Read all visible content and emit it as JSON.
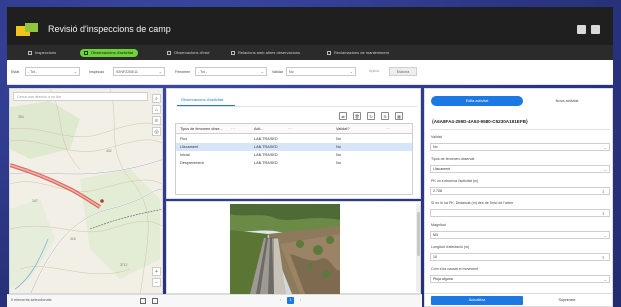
{
  "app": {
    "title": "Revisió d'inspeccions de camp"
  },
  "tabs": [
    {
      "label": "Inspeccions",
      "active": false
    },
    {
      "label": "Observacions d'activitat",
      "active": true
    },
    {
      "label": "Observacions d'inici",
      "active": false
    },
    {
      "label": "Relacions amb altres observacions",
      "active": false
    },
    {
      "label": "Reclamacions de manteniment",
      "active": false
    }
  ],
  "filters": {
    "f1_label": "Estat",
    "f1_value": "- Tot -",
    "f2_label": "Inspecció",
    "f2_value": "S/INF2208/11",
    "f3_label": "Fenomen",
    "f3_value": "- Tot -",
    "f4_label": "Validat",
    "f4_value": "No",
    "apply_label": "Aplica",
    "reset_label": "Esborra"
  },
  "map": {
    "search_placeholder": "Cerca una direcció o un lloc",
    "labels": [
      "354",
      "402",
      "347",
      "318",
      "3712"
    ],
    "zoom_in": "+",
    "zoom_out": "−"
  },
  "footer": {
    "selection_text": "0 elements seleccionats"
  },
  "observations": {
    "tab_label": "Observacions d'activitat",
    "columns": [
      "Tipus de fenomen obse...",
      "Acti...",
      "Validat?"
    ],
    "rows": [
      {
        "type": "Flux",
        "activity": "LAB.TRASED",
        "valid": "No",
        "selected": false
      },
      {
        "type": "Lliscament",
        "activity": "LAB.TRASED",
        "valid": "No",
        "selected": true
      },
      {
        "type": "Inicial",
        "activity": "LAB.TRASED",
        "valid": "No",
        "selected": false
      },
      {
        "type": "Despreniment",
        "activity": "LAB.TRASED",
        "valid": "No",
        "selected": false
      }
    ]
  },
  "form": {
    "tab_primary": "Edita activitat",
    "tab_secondary": "Nova activitat",
    "record_id": "{A6A8FA4-259D-4A53-9580-C5230A191EFB}",
    "fields": [
      {
        "label": "Validat",
        "value": "No",
        "kind": "select"
      },
      {
        "label": "Tipus de fenomen observat",
        "value": "Lliscament",
        "kind": "select"
      },
      {
        "label": "PK on s'observa l'activitat (m)",
        "value": "2.708",
        "kind": "number"
      },
      {
        "label": "Si no hi ha PK, Distància (m) des de l'inici de l'arbre",
        "value": "",
        "kind": "number"
      },
      {
        "label": "Magnitud",
        "value": "M3",
        "kind": "select"
      },
      {
        "label": "Longitud d'afectació (m)",
        "value": "10",
        "kind": "number"
      },
      {
        "label": "Com s'ha causat el moviment",
        "value": "Pluja alguna",
        "kind": "select"
      }
    ],
    "save_label": "Actualitza",
    "delete_label": "Suprimeix"
  },
  "colors": {
    "accent": "#1c78e3",
    "active_tab": "#6ed23a",
    "header": "#1f1f1f"
  }
}
